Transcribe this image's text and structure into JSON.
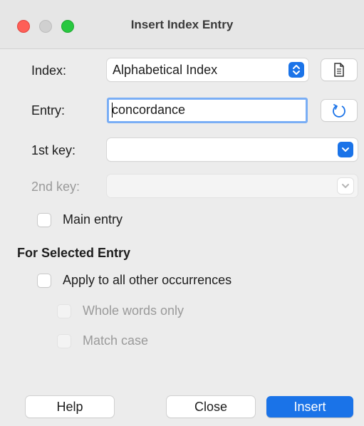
{
  "window": {
    "title": "Insert Index Entry"
  },
  "fields": {
    "index": {
      "label": "Index:",
      "value": "Alphabetical Index"
    },
    "entry": {
      "label": "Entry:",
      "value": "concordance"
    },
    "key1": {
      "label": "1st key:",
      "value": ""
    },
    "key2": {
      "label": "2nd key:",
      "value": ""
    }
  },
  "checks": {
    "main_entry": "Main entry",
    "apply_all": "Apply to all other occurrences",
    "whole_words": "Whole words only",
    "match_case": "Match case"
  },
  "section_title": "For Selected Entry",
  "buttons": {
    "help": "Help",
    "close": "Close",
    "insert": "Insert"
  },
  "colors": {
    "accent": "#1a73e8",
    "close_light": "#fe5f57",
    "zoom_light": "#28c840"
  },
  "icons": {
    "new_index": "new-index-document-icon",
    "update": "update-refresh-icon",
    "combo_arrow": "chevron-down-icon",
    "combo_stepper": "updown-stepper-icon"
  }
}
